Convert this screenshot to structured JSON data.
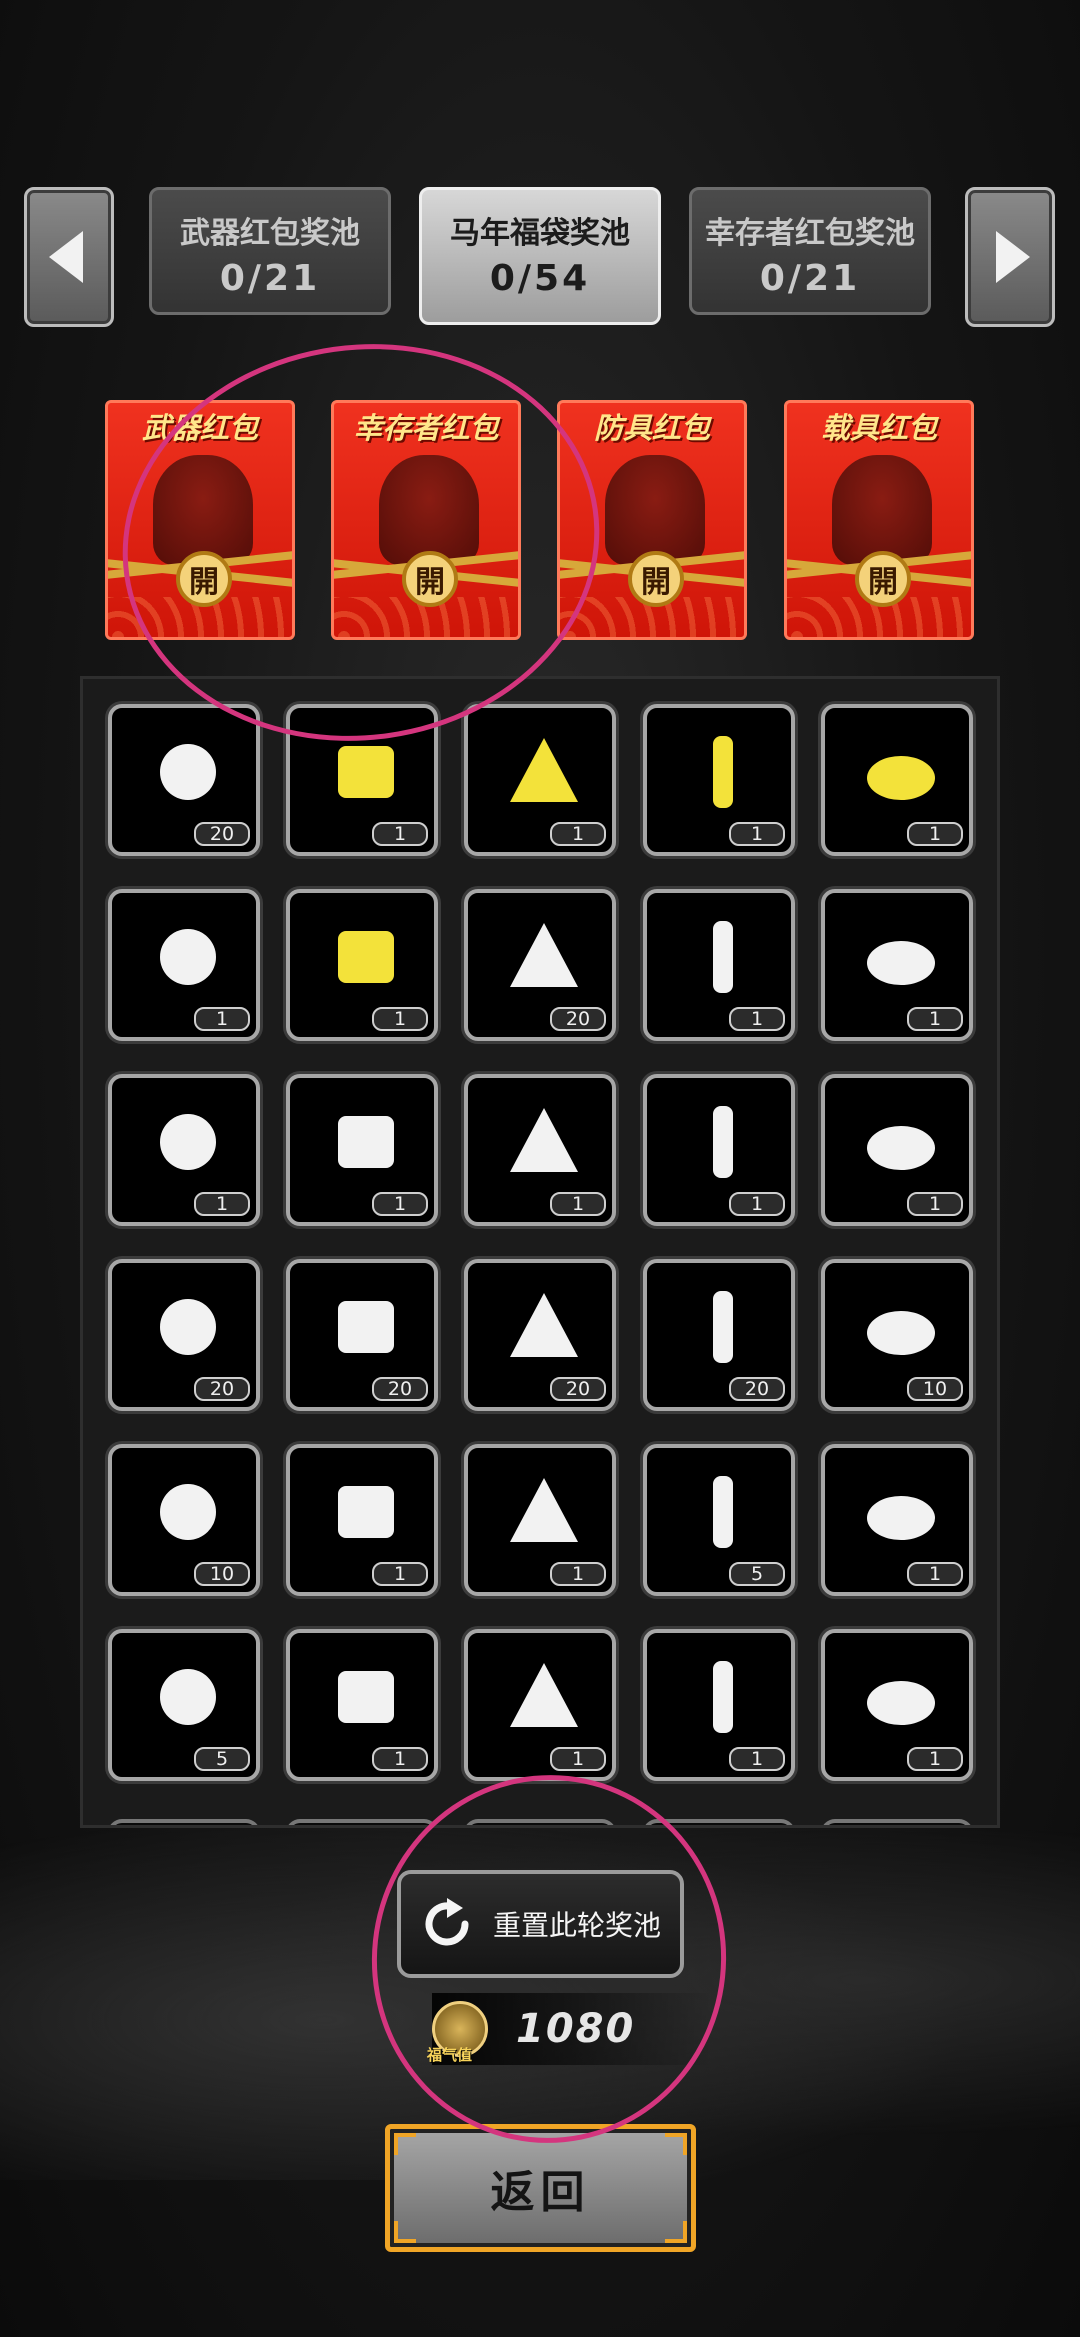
{
  "tabs": [
    {
      "name": "武器红包奖池",
      "count": "0/21",
      "active": false
    },
    {
      "name": "马年福袋奖池",
      "count": "0/54",
      "active": true
    },
    {
      "name": "幸存者红包奖池",
      "count": "0/21",
      "active": false
    }
  ],
  "packets": [
    {
      "title": "武器红包",
      "seal": "開"
    },
    {
      "title": "幸存者红包",
      "seal": "開"
    },
    {
      "title": "防具红包",
      "seal": "開"
    },
    {
      "title": "载具红包",
      "seal": "開"
    }
  ],
  "items": [
    {
      "icon": "glue-tube-icon",
      "count": "20"
    },
    {
      "icon": "flask-icon",
      "count": "1"
    },
    {
      "icon": "gold-nuggets-icon",
      "count": "1"
    },
    {
      "icon": "wood-planks-icon",
      "count": "1"
    },
    {
      "icon": "gold-mechanism-icon",
      "count": "1"
    },
    {
      "icon": "cloth-icon",
      "count": "1"
    },
    {
      "icon": "gold-sticks-icon",
      "count": "1"
    },
    {
      "icon": "cash-stack-icon",
      "count": "20"
    },
    {
      "icon": "silver-bars-icon",
      "count": "1"
    },
    {
      "icon": "vase-icon",
      "count": "1"
    },
    {
      "icon": "ring-icon",
      "count": "1"
    },
    {
      "icon": "sugar-bowl-icon",
      "count": "1"
    },
    {
      "icon": "coffee-cup-icon",
      "count": "1"
    },
    {
      "icon": "food-bowl-icon",
      "count": "1"
    },
    {
      "icon": "toolbox-icon",
      "count": "1"
    },
    {
      "icon": "batteries-icon",
      "count": "20"
    },
    {
      "icon": "bullet-icon",
      "count": "20"
    },
    {
      "icon": "fuel-can-icon",
      "count": "20"
    },
    {
      "icon": "rifle-round-icon",
      "count": "20"
    },
    {
      "icon": "pen-icon",
      "count": "10"
    },
    {
      "icon": "medicine-tube-icon",
      "count": "10"
    },
    {
      "icon": "drink-glass-icon",
      "count": "1"
    },
    {
      "icon": "pickle-jar-icon",
      "count": "1"
    },
    {
      "icon": "net-icon",
      "count": "5"
    },
    {
      "icon": "lemonade-icon",
      "count": "1"
    },
    {
      "icon": "mesh-dome-icon",
      "count": "5"
    },
    {
      "icon": "skewers-icon",
      "count": "1"
    },
    {
      "icon": "fabric-stack-icon",
      "count": "1"
    },
    {
      "icon": "meat-chunk-icon",
      "count": "1"
    },
    {
      "icon": "bottle-icon",
      "count": "1"
    }
  ],
  "reset_button": {
    "label": "重置此轮奖池"
  },
  "fortune": {
    "label": "福气值",
    "value": "1080"
  },
  "back_button": {
    "label": "返回"
  },
  "colors": {
    "annotation": "#d4357e",
    "packet_red": "#e52a17",
    "gold": "#f0a526"
  }
}
